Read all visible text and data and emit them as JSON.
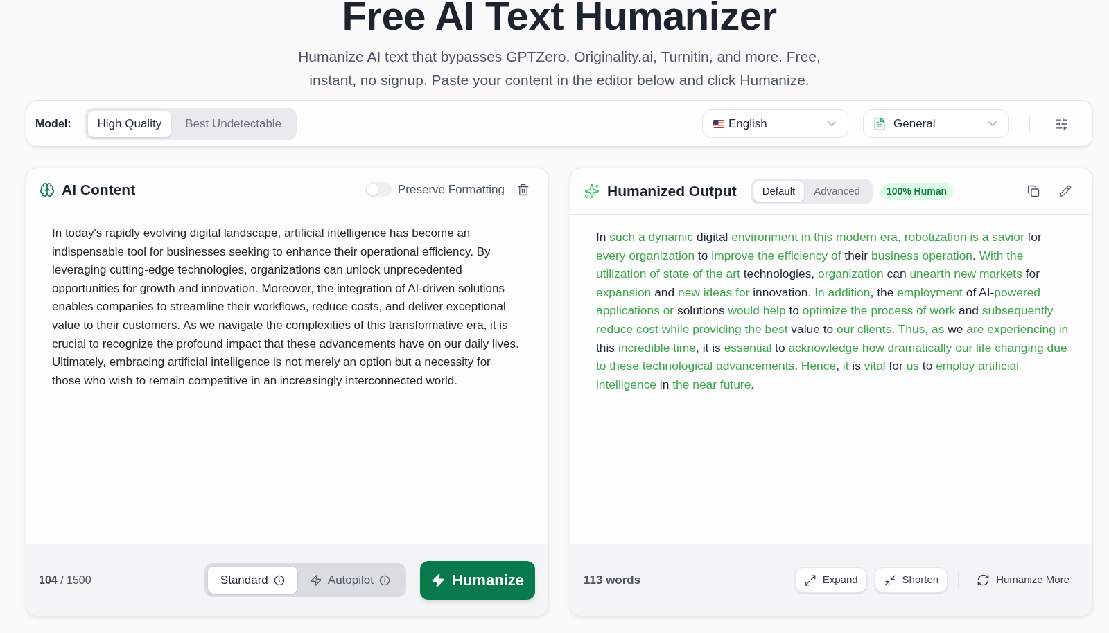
{
  "header": {
    "title": "Free AI Text Humanizer",
    "subtitle": "Humanize AI text that bypasses GPTZero, Originality.ai, Turnitin, and more. Free, instant, no signup. Paste your content in the editor below and click Humanize."
  },
  "toolbar": {
    "model_label": "Model:",
    "models": [
      {
        "label": "High Quality",
        "selected": true
      },
      {
        "label": "Best Undetectable",
        "selected": false
      }
    ],
    "language": {
      "value": "English"
    },
    "tone": {
      "value": "General"
    }
  },
  "input_panel": {
    "title": "AI Content",
    "preserve_formatting": {
      "label": "Preserve Formatting",
      "on": false
    },
    "text": "In today's rapidly evolving digital landscape, artificial intelligence has become an indispensable tool for businesses seeking to enhance their operational efficiency. By leveraging cutting-edge technologies, organizations can unlock unprecedented opportunities for growth and innovation. Moreover, the integration of AI-driven solutions enables companies to streamline their workflows, reduce costs, and deliver exceptional value to their customers. As we navigate the complexities of this transformative era, it is crucial to recognize the profound impact that these advancements have on our daily lives. Ultimately, embracing artificial intelligence is not merely an option but a necessity for those who wish to remain competitive in an increasingly interconnected world.",
    "counter": "**104** / 1500",
    "modes": [
      {
        "kind": "standard",
        "label": "Standard",
        "selected": true
      },
      {
        "kind": "autopilot",
        "label": "Autopilot",
        "selected": false
      }
    ],
    "submit": "Humanize"
  },
  "output_panel": {
    "title": "Humanized Output",
    "views": [
      {
        "label": "Default",
        "selected": true
      },
      {
        "label": "Advanced",
        "selected": false
      }
    ],
    "badge": "100% Human",
    "segments": [
      {
        "text": "In ",
        "changed": false
      },
      {
        "text": "such a dynamic",
        "changed": true
      },
      {
        "text": " digital ",
        "changed": false
      },
      {
        "text": "environment in this modern era, robotization is a savior",
        "changed": true
      },
      {
        "text": " for ",
        "changed": false
      },
      {
        "text": "every organization",
        "changed": true
      },
      {
        "text": " to ",
        "changed": false
      },
      {
        "text": "improve the efficiency of",
        "changed": true
      },
      {
        "text": " their ",
        "changed": false
      },
      {
        "text": "business operation",
        "changed": true
      },
      {
        "text": ". ",
        "changed": false
      },
      {
        "text": "With the utilization of state of the art",
        "changed": true
      },
      {
        "text": " technologies, ",
        "changed": false
      },
      {
        "text": "organization",
        "changed": true
      },
      {
        "text": " can ",
        "changed": false
      },
      {
        "text": "unearth new markets",
        "changed": true
      },
      {
        "text": " for ",
        "changed": false
      },
      {
        "text": "expansion",
        "changed": true
      },
      {
        "text": " and ",
        "changed": false
      },
      {
        "text": "new ideas for",
        "changed": true
      },
      {
        "text": " innovation. ",
        "changed": false
      },
      {
        "text": "In addition",
        "changed": true
      },
      {
        "text": ", the ",
        "changed": false
      },
      {
        "text": "employment",
        "changed": true
      },
      {
        "text": " of AI-",
        "changed": false
      },
      {
        "text": "powered applications or",
        "changed": true
      },
      {
        "text": " solutions ",
        "changed": false
      },
      {
        "text": "would help",
        "changed": true
      },
      {
        "text": " to ",
        "changed": false
      },
      {
        "text": "optimize the process of work",
        "changed": true
      },
      {
        "text": " and ",
        "changed": false
      },
      {
        "text": "subsequently reduce cost while providing the best",
        "changed": true
      },
      {
        "text": " value to ",
        "changed": false
      },
      {
        "text": "our clients",
        "changed": true
      },
      {
        "text": ". ",
        "changed": false
      },
      {
        "text": "Thus, as",
        "changed": true
      },
      {
        "text": " we ",
        "changed": false
      },
      {
        "text": "are experiencing in",
        "changed": true
      },
      {
        "text": " this ",
        "changed": false
      },
      {
        "text": "incredible time",
        "changed": true
      },
      {
        "text": ", it is ",
        "changed": false
      },
      {
        "text": "essential",
        "changed": true
      },
      {
        "text": " to ",
        "changed": false
      },
      {
        "text": "acknowledge how dramatically our life changing due to these technological advancements",
        "changed": true
      },
      {
        "text": ". ",
        "changed": false
      },
      {
        "text": "Hence",
        "changed": true
      },
      {
        "text": ", ",
        "changed": false
      },
      {
        "text": "it",
        "changed": true
      },
      {
        "text": " is ",
        "changed": false
      },
      {
        "text": "vital",
        "changed": true
      },
      {
        "text": " for ",
        "changed": false
      },
      {
        "text": "us",
        "changed": true
      },
      {
        "text": " to ",
        "changed": false
      },
      {
        "text": "employ artificial intelligence",
        "changed": true
      },
      {
        "text": " in ",
        "changed": false
      },
      {
        "text": "the near future",
        "changed": true
      },
      {
        "text": ".",
        "changed": false
      }
    ],
    "word_count": "113 words",
    "actions": [
      {
        "kind": "expand",
        "label": "Expand"
      },
      {
        "kind": "shorten",
        "label": "Shorten"
      },
      {
        "kind": "rewrite",
        "label": "Humanize More"
      }
    ]
  }
}
